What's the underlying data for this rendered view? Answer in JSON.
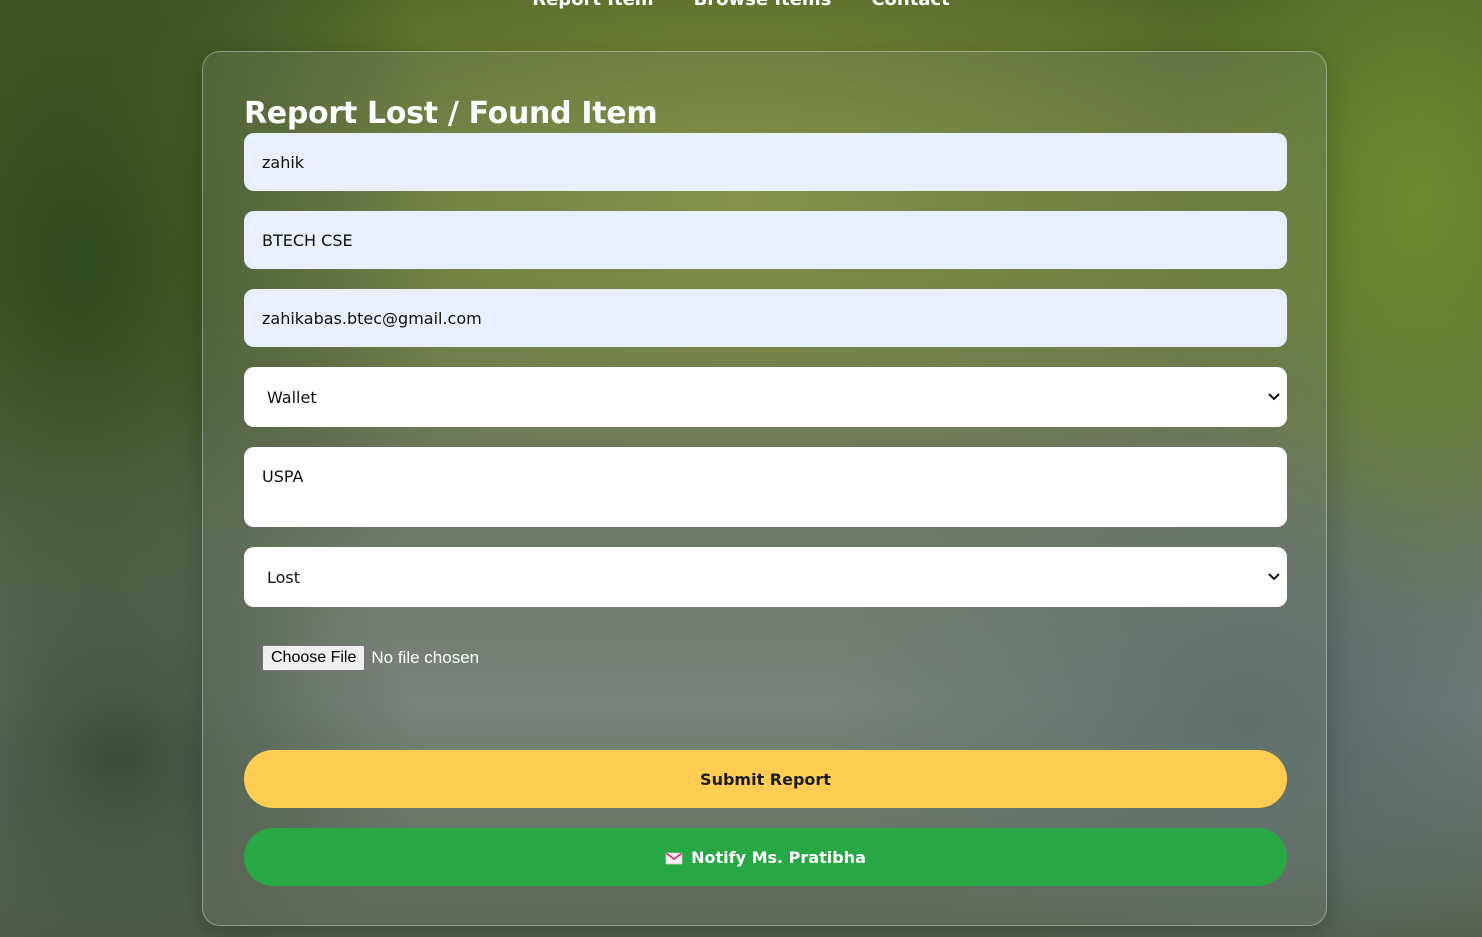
{
  "nav": {
    "items": [
      "Report Item",
      "Browse Items",
      "Contact"
    ]
  },
  "form": {
    "title": "Report Lost / Found Item",
    "name_value": "zahik",
    "course_value": "BTECH CSE",
    "email_value": "zahikabas.btec@gmail.com",
    "category_selected": "Wallet",
    "location_value": "USPA",
    "status_selected": "Lost",
    "file_button_label": "Choose File",
    "file_status": "No file chosen",
    "submit_label": "Submit Report",
    "notify_label": "Notify Ms. Pratibha",
    "notify_icon": "envelope-icon"
  },
  "colors": {
    "submit_bg": "#fecd52",
    "notify_bg": "#28a745",
    "autofill_bg": "#e8effd"
  }
}
